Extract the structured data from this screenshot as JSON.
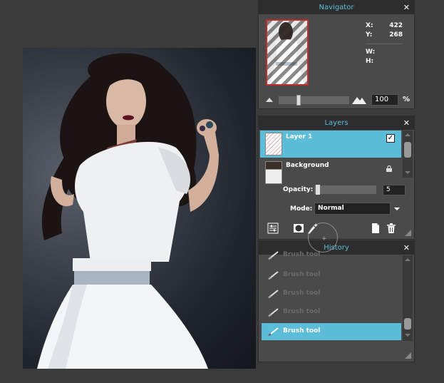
{
  "canvas": {
    "image_icon": "portrait-photo"
  },
  "navigator": {
    "title": "Navigator",
    "close": "✕",
    "x_label": "X:",
    "x_value": "422",
    "y_label": "Y:",
    "y_value": "268",
    "w_label": "W:",
    "w_value": "",
    "h_label": "H:",
    "h_value": "",
    "zoom_value": "100",
    "zoom_unit": "%"
  },
  "layers": {
    "title": "Layers",
    "close": "✕",
    "items": [
      {
        "name": "Layer 1",
        "visible_check": "✓"
      },
      {
        "name": "Background"
      }
    ],
    "opacity_label": "Opacity:",
    "opacity_value": "5",
    "mode_label": "Mode:",
    "mode_value": "Normal"
  },
  "history": {
    "title": "History",
    "close": "✕",
    "items": [
      {
        "label": "Brush tool"
      },
      {
        "label": "Brush tool"
      },
      {
        "label": "Brush tool"
      },
      {
        "label": "Brush tool"
      },
      {
        "label": "Brush tool"
      },
      {
        "label": "Brush tool"
      }
    ]
  },
  "colors": {
    "accent": "#5bbdd8",
    "panel": "#4a4a4a",
    "titlebar": "#2d2d2d",
    "background": "#3b3b3b"
  }
}
